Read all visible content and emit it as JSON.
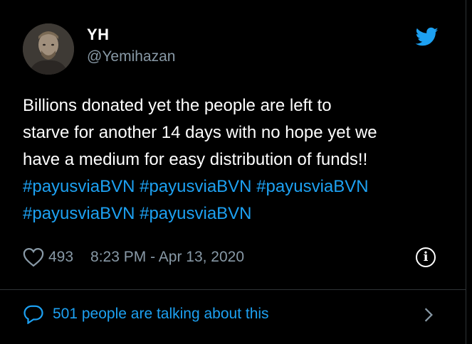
{
  "colors": {
    "background": "#000000",
    "text": "#ffffff",
    "muted": "#8899a6",
    "accent": "#1da1f2",
    "divider": "#2f3336"
  },
  "author": {
    "name": "YH",
    "handle": "@Yemihazan",
    "avatar_icon": "avatar"
  },
  "brand_icon": "twitter-bird-icon",
  "tweet": {
    "lines": [
      "Billions donated yet the people are left to",
      "starve for another 14 days with no hope yet we",
      "have a medium for easy distribution of funds!!"
    ],
    "hashtags_line1": [
      "#payusviaBVN",
      "#payusviaBVN",
      "#payusviaBVN"
    ],
    "hashtags_line2": [
      "#payusviaBVN",
      "#payusviaBVN"
    ]
  },
  "meta": {
    "like_count": "493",
    "timestamp": "8:23 PM - Apr 13, 2020",
    "info_symbol": "i"
  },
  "footer": {
    "talking_text": "501 people are talking about this"
  }
}
